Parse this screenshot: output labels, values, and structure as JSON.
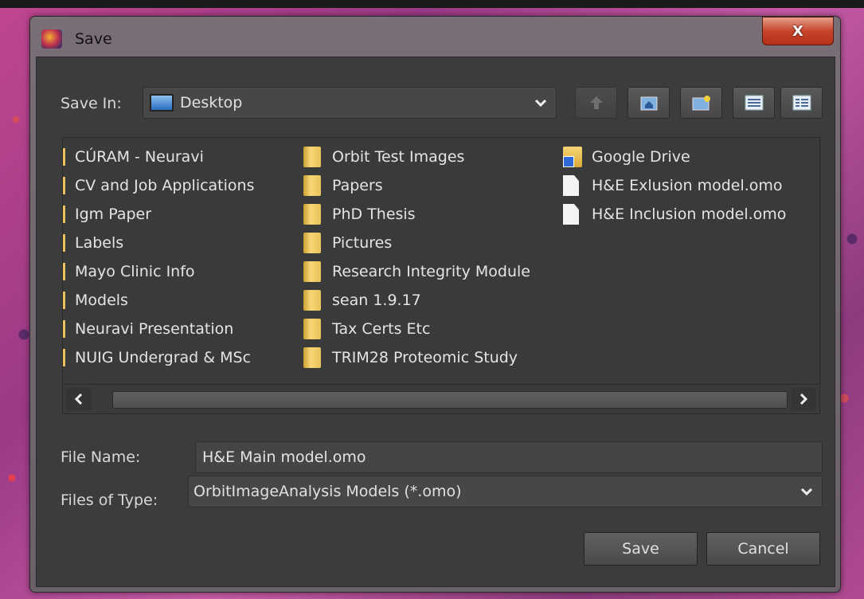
{
  "window": {
    "title": "Save",
    "close_glyph": "X"
  },
  "save_in": {
    "label": "Save In:",
    "value": "Desktop"
  },
  "toolbar": {
    "icons": [
      "up-one-level-icon",
      "home-icon",
      "new-folder-icon",
      "list-view-icon",
      "details-view-icon"
    ]
  },
  "files": {
    "column1": [
      "CÚRAM - Neuravi",
      "CV and Job Applications",
      "Igm Paper",
      "Labels",
      "Mayo Clinic Info",
      "Models",
      "Neuravi Presentation",
      "NUIG Undergrad & MSc"
    ],
    "column2": [
      "Orbit Test Images",
      "Papers",
      "PhD Thesis",
      "Pictures",
      "Research Integrity Module",
      "sean 1.9.17",
      "Tax Certs Etc",
      "TRIM28 Proteomic Study"
    ],
    "column3": [
      "Google Drive",
      "H&E Exlusion model.omo",
      "H&E Inclusion model.omo"
    ]
  },
  "file_name": {
    "label": "File Name:",
    "value": "H&E Main model.omo"
  },
  "file_type": {
    "label": "Files of Type:",
    "value": "OrbitImageAnalysis Models (*.omo)"
  },
  "buttons": {
    "save": "Save",
    "cancel": "Cancel"
  }
}
